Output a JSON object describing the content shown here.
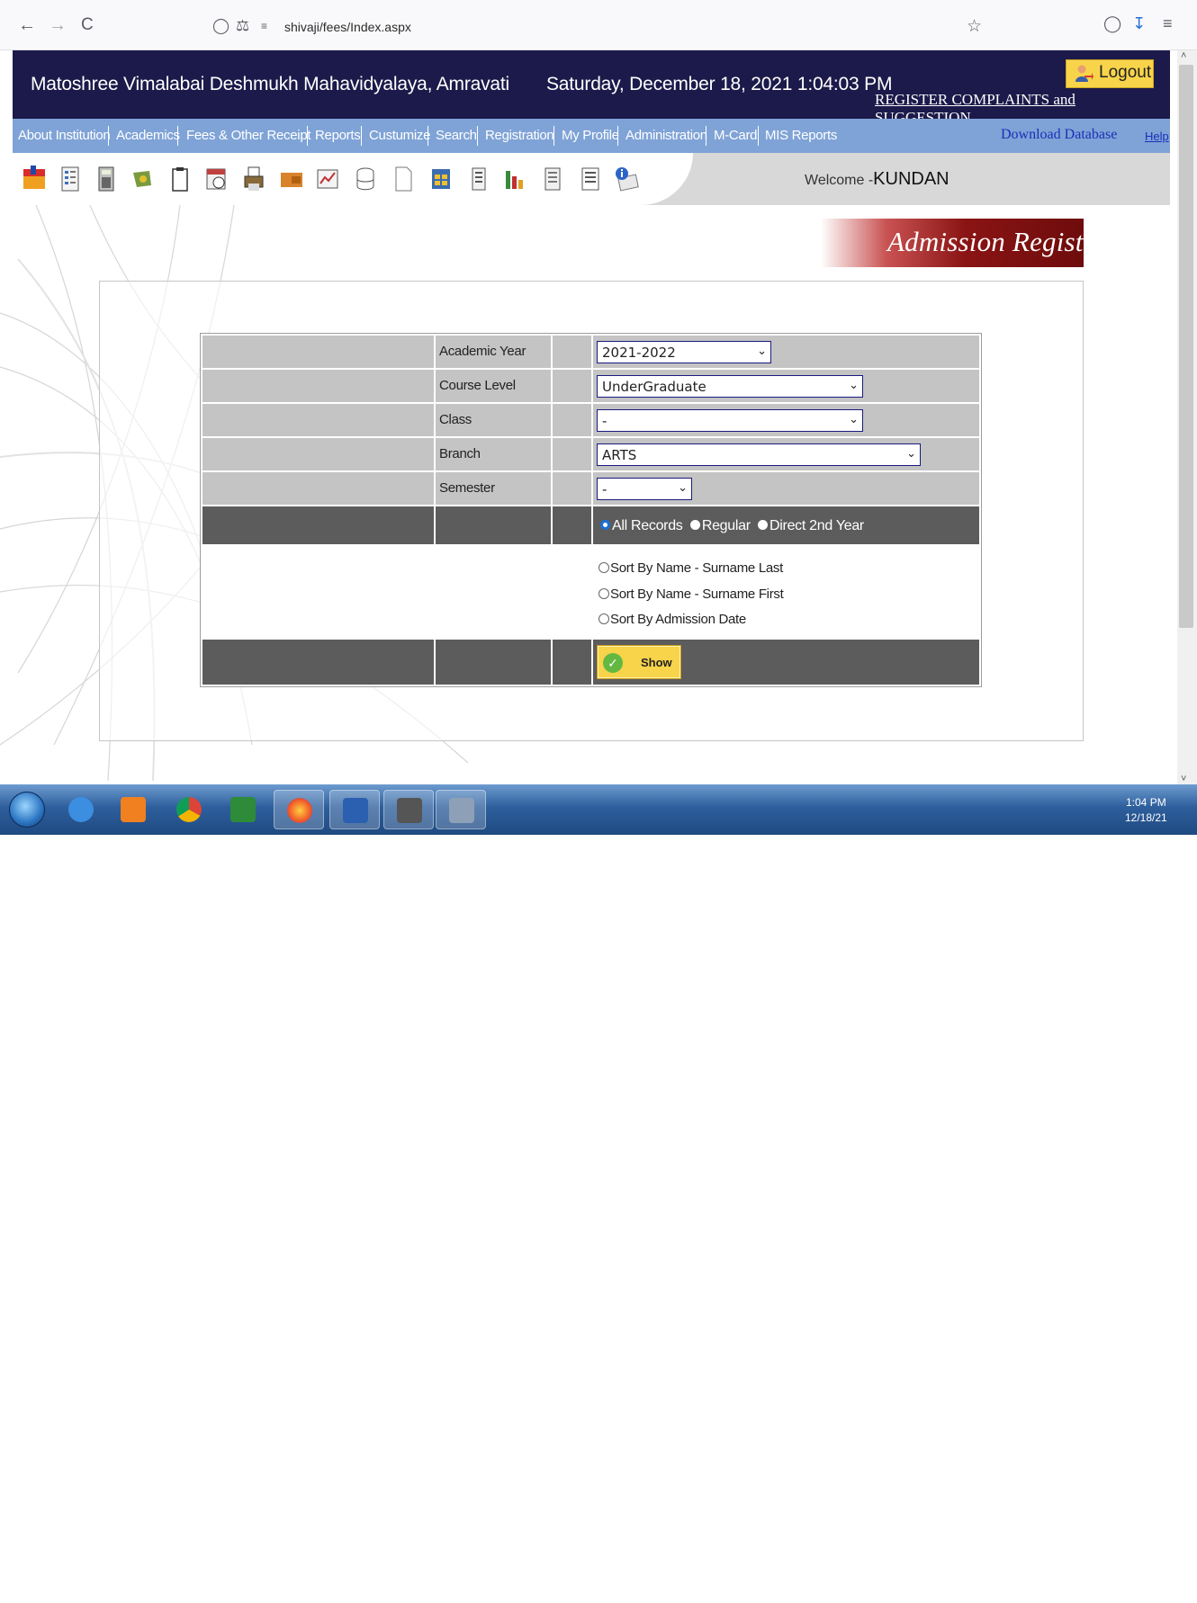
{
  "browser": {
    "url": "shivaji/fees/Index.aspx",
    "back": "←",
    "forward": "→",
    "reload": "C"
  },
  "header": {
    "institution": "Matoshree Vimalabai Deshmukh Mahavidyalaya, Amravati",
    "datetime": "Saturday, December 18, 2021 1:04:03 PM",
    "logout_label": "Logout",
    "register_link": "REGISTER COMPLAINTS and SUGGESTION"
  },
  "menu": {
    "items": [
      {
        "label": "About Institution"
      },
      {
        "label": "Academics"
      },
      {
        "label": "Fees & Other Receipt"
      },
      {
        "label": "Reports"
      },
      {
        "label": "Custumize"
      },
      {
        "label": "Search"
      },
      {
        "label": "Registration"
      },
      {
        "label": "My Profile"
      },
      {
        "label": "Administration"
      },
      {
        "label": "M-Card"
      },
      {
        "label": "MIS Reports"
      }
    ],
    "download": "Download Database",
    "help": "Help"
  },
  "toolbar": {
    "welcome_prefix": "Welcome -",
    "user": "KUNDAN",
    "icons": [
      "exit-icon",
      "list-icon",
      "calculator-icon",
      "money-icon",
      "clipboard-icon",
      "calendar-icon",
      "printer-icon",
      "wallet-icon",
      "presentation-icon",
      "sheet-icon",
      "database-icon",
      "document-icon",
      "spreadsheet-icon",
      "ledger-icon",
      "bar-chart-icon",
      "notes-icon",
      "report-icon",
      "info-mail-icon"
    ]
  },
  "page": {
    "title": "Admission Register"
  },
  "form": {
    "academic_year": {
      "label": "Academic Year",
      "value": "2021-2022"
    },
    "course_level": {
      "label": "Course Level",
      "value": "UnderGraduate"
    },
    "class": {
      "label": "Class",
      "value": "-"
    },
    "branch": {
      "label": "Branch",
      "value": "ARTS"
    },
    "semester": {
      "label": "Semester",
      "value": "-"
    },
    "record_filter": {
      "options": [
        "All Records",
        "Regular",
        "Direct 2nd Year"
      ],
      "selected": "All Records"
    },
    "sort_options": [
      "Sort By Name - Surname Last",
      "Sort By Name - Surname First",
      "Sort By Admission Date"
    ],
    "show_label": "Show"
  },
  "taskbar": {
    "time": "1:04 PM",
    "date": "12/18/21"
  }
}
